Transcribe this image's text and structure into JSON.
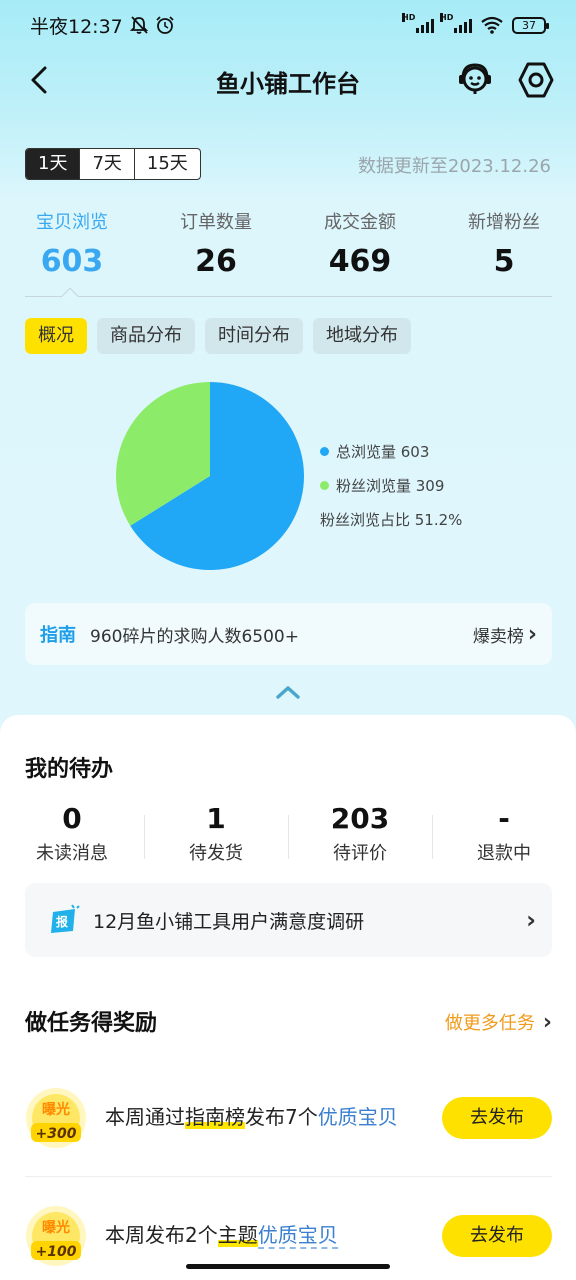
{
  "status_bar": {
    "time": "半夜12:37",
    "signal_label": "HD",
    "battery": "37",
    "icons": [
      "bell-muted-icon",
      "alarm-icon",
      "signal-icon",
      "wifi-icon",
      "battery-icon"
    ]
  },
  "nav": {
    "title": "鱼小铺工作台",
    "icons": [
      "back-icon",
      "customer-service-icon",
      "settings-icon"
    ]
  },
  "range": {
    "tabs": [
      "1天",
      "7天",
      "15天"
    ],
    "active": "1天",
    "updated": "数据更新至2023.12.26"
  },
  "metrics": [
    {
      "label": "宝贝浏览",
      "value": "603",
      "active": true
    },
    {
      "label": "订单数量",
      "value": "26",
      "active": false
    },
    {
      "label": "成交金额",
      "value": "469",
      "active": false
    },
    {
      "label": "新增粉丝",
      "value": "5",
      "active": false
    }
  ],
  "segments": {
    "tabs": [
      "概况",
      "商品分布",
      "时间分布",
      "地域分布"
    ],
    "active": "概况"
  },
  "chart_data": {
    "type": "pie",
    "title": "",
    "slices": [
      {
        "label": "总浏览量",
        "value": 603,
        "color": "#20a7f5"
      },
      {
        "label": "粉丝浏览量",
        "value": 309,
        "color": "#8cec6a"
      }
    ],
    "legend": [
      {
        "text": "总浏览量 603",
        "color": "#20a7f5"
      },
      {
        "text": "粉丝浏览量 309",
        "color": "#8cec6a"
      }
    ],
    "note": "粉丝浏览占比 51.2%",
    "legend_placement": "right"
  },
  "guide": {
    "tag": "指南",
    "text": "960碎片的求购人数6500+",
    "link": "爆卖榜",
    "chevron": "›"
  },
  "todo": {
    "title": "我的待办",
    "stats": [
      {
        "value": "0",
        "label": "未读消息"
      },
      {
        "value": "1",
        "label": "待发货"
      },
      {
        "value": "203",
        "label": "待评价"
      },
      {
        "value": "-",
        "label": "退款中"
      }
    ],
    "survey": {
      "icon_text": "报",
      "text": "12月鱼小铺工具用户满意度调研",
      "chevron": "›"
    }
  },
  "tasks": {
    "title": "做任务得奖励",
    "more": "做更多任务",
    "chevron": "›",
    "items": [
      {
        "badge_top": "曝光",
        "badge_bottom": "+300",
        "parts": [
          "本周通过",
          "指南榜",
          "发布7个",
          "优质宝贝"
        ],
        "button": "去发布"
      },
      {
        "badge_top": "曝光",
        "badge_bottom": "+100",
        "parts": [
          "本周发布2个",
          "主题",
          "优质宝贝"
        ],
        "button": "去发布"
      }
    ]
  },
  "colors": {
    "accent_blue": "#3aa8f0",
    "brand_yellow": "#ffe100",
    "task_orange": "#f29a1a",
    "header_bg": "#a6ecf7"
  }
}
